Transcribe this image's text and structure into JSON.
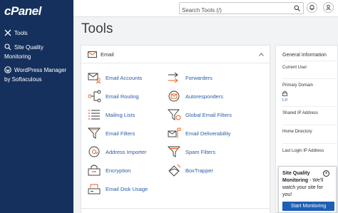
{
  "sidebar": {
    "logo": "cPanel",
    "items": [
      {
        "label": "Tools",
        "icon": "tools-icon"
      },
      {
        "label": "Site Quality Monitoring",
        "icon": "site-quality-icon"
      },
      {
        "label": "WordPress Manager by Softaculous",
        "icon": "wordpress-icon"
      }
    ]
  },
  "header": {
    "search_placeholder": "Search Tools (/)"
  },
  "page": {
    "title": "Tools"
  },
  "email_panel": {
    "title": "Email",
    "tools": [
      {
        "label": "Email Accounts",
        "icon": "email-accounts-icon"
      },
      {
        "label": "Forwarders",
        "icon": "forwarders-icon"
      },
      {
        "label": "Email Routing",
        "icon": "email-routing-icon"
      },
      {
        "label": "Autoresponders",
        "icon": "autoresponders-icon"
      },
      {
        "label": "Mailing Lists",
        "icon": "mailing-lists-icon"
      },
      {
        "label": "Global Email Filters",
        "icon": "global-filter-icon"
      },
      {
        "label": "Email Filters",
        "icon": "email-filter-icon"
      },
      {
        "label": "Email Deliverability",
        "icon": "deliverability-icon"
      },
      {
        "label": "Address Importer",
        "icon": "address-importer-icon"
      },
      {
        "label": "Spam Filters",
        "icon": "spam-filter-icon"
      },
      {
        "label": "Encryption",
        "icon": "encryption-icon"
      },
      {
        "label": "BoxTrapper",
        "icon": "boxtrapper-icon"
      },
      {
        "label": "Email Disk Usage",
        "icon": "disk-usage-icon"
      }
    ]
  },
  "info_panel": {
    "title": "General Information",
    "current_user": "Current User",
    "primary_domain": "Primary Domain",
    "domain_link": "t.rr",
    "shared_ip": "Shared IP Address",
    "home_directory": "Home Directory",
    "last_login_ip": "Last Login IP Address"
  },
  "popup": {
    "title": "Site Quality Monitoring",
    "text": " - We'll watch your site for you!",
    "button": "Start Monitoring"
  },
  "colors": {
    "sidebar_bg": "#15305c",
    "link": "#2a5ca8",
    "icon_orange": "#e85d1a",
    "button": "#1d5fb4"
  }
}
